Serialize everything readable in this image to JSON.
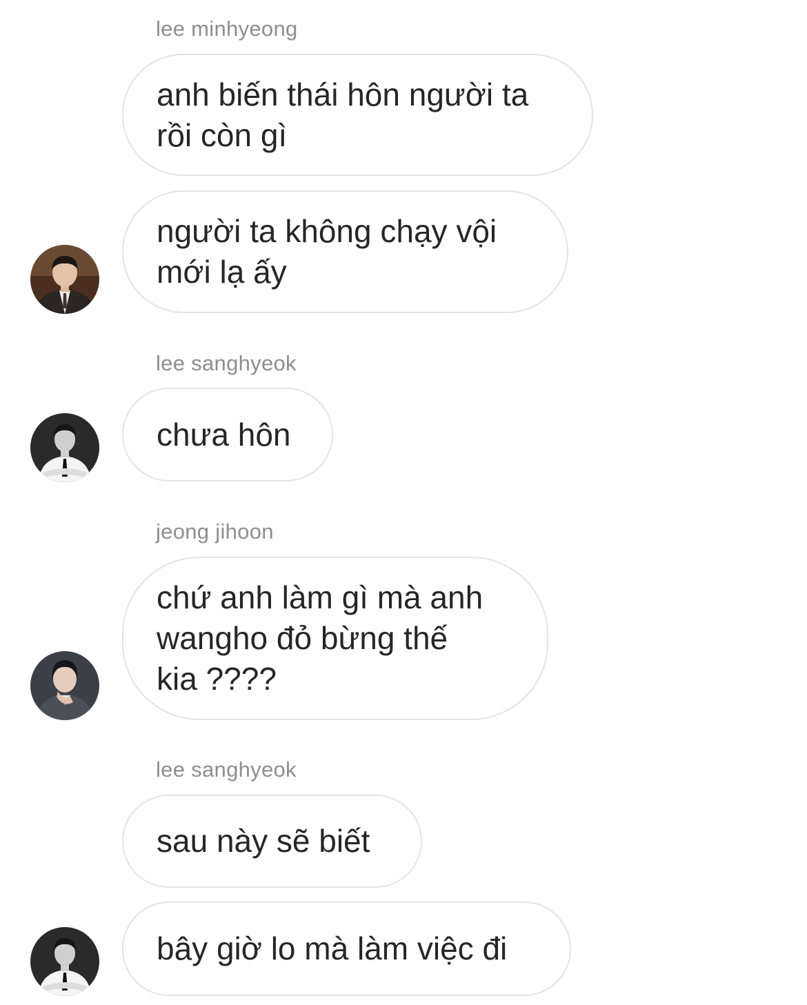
{
  "messages": [
    {
      "sender": "lee minhyeong",
      "text": "anh biến thái hôn người ta\nrồi còn gì"
    },
    {
      "text": "người ta không chạy vội\nmới lạ ấy",
      "avatar": "profile-photo-minhyeong"
    },
    {
      "sender": "lee sanghyeok",
      "text": "chưa hôn",
      "avatar": "profile-photo-sanghyeok"
    },
    {
      "sender": "jeong jihoon",
      "text": "chứ anh làm gì mà anh\nwangho đỏ bừng thế\nkia ????",
      "avatar": "profile-photo-jihoon"
    },
    {
      "sender": "lee sanghyeok",
      "text": "sau này sẽ biết"
    },
    {
      "text": "bây giờ lo mà làm việc đi",
      "avatar": "profile-photo-sanghyeok"
    }
  ]
}
